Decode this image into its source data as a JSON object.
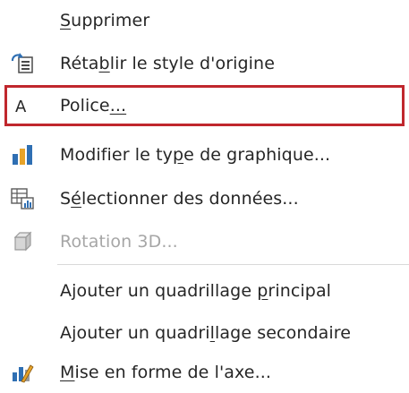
{
  "menu": {
    "items": [
      {
        "id": "supprimer",
        "pre": "",
        "ul": "S",
        "post": "upprimer",
        "icon": "",
        "disabled": false
      },
      {
        "id": "retablir",
        "pre": "Réta",
        "ul": "b",
        "post": "lir le style d'origine",
        "icon": "reset-style-icon",
        "disabled": false
      },
      {
        "id": "police",
        "pre": "Police",
        "ul": "...",
        "post": "",
        "icon": "font-icon",
        "disabled": false,
        "highlighted": true
      },
      {
        "id": "modifier-type",
        "pre": "Modifier le ty",
        "ul": "p",
        "post": "e de graphique...",
        "icon": "chart-type-icon",
        "disabled": false
      },
      {
        "id": "selectionner",
        "pre": "S",
        "ul": "é",
        "post": "lectionner des données...",
        "icon": "select-data-icon",
        "disabled": false
      },
      {
        "id": "rotation",
        "pre": "Rotation 3D...",
        "ul": "",
        "post": "",
        "icon": "cube-3d-icon",
        "disabled": true
      },
      {
        "id": "quadrillage-principal",
        "pre": "Ajouter un quadrillage ",
        "ul": "p",
        "post": "rincipal",
        "icon": "",
        "disabled": false
      },
      {
        "id": "quadrillage-secondaire",
        "pre": "Ajouter un quadri",
        "ul": "l",
        "post": "lage secondaire",
        "icon": "",
        "disabled": false
      },
      {
        "id": "mise-en-forme",
        "pre": "",
        "ul": "M",
        "post": "ise en forme de l'axe...",
        "icon": "format-axis-icon",
        "disabled": false
      }
    ]
  },
  "colors": {
    "highlight": "#c0272d",
    "text": "#262626",
    "disabled": "#a6a6a6"
  }
}
